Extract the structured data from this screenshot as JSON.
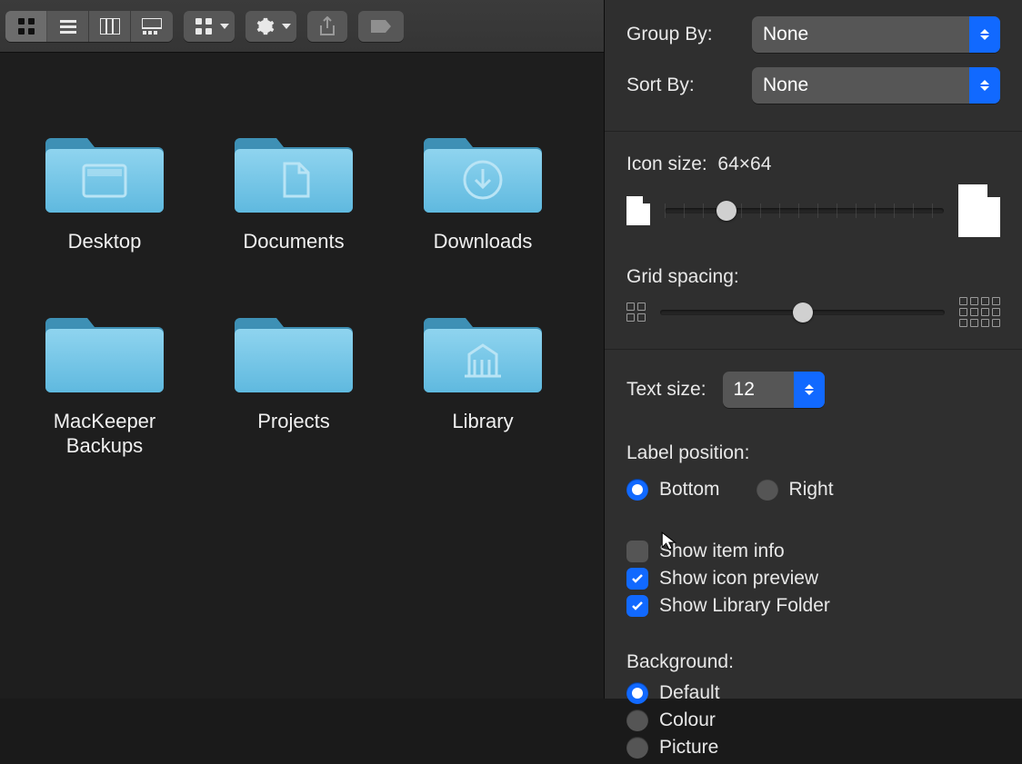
{
  "toolbar": {
    "view_modes": [
      "icon",
      "list",
      "column",
      "gallery"
    ],
    "active_view": "icon"
  },
  "folders": [
    {
      "name": "Desktop",
      "icon": "desktop"
    },
    {
      "name": "Documents",
      "icon": "document"
    },
    {
      "name": "Downloads",
      "icon": "download"
    },
    {
      "name": "MacKeeper Backups",
      "icon": "plain"
    },
    {
      "name": "Projects",
      "icon": "plain"
    },
    {
      "name": "Library",
      "icon": "library"
    }
  ],
  "options": {
    "group_by": {
      "label": "Group By:",
      "value": "None"
    },
    "sort_by": {
      "label": "Sort By:",
      "value": "None"
    },
    "icon_size": {
      "label": "Icon size:",
      "value": "64×64",
      "percent": 22
    },
    "grid_spacing": {
      "label": "Grid spacing:",
      "percent": 50
    },
    "text_size": {
      "label": "Text size:",
      "value": "12"
    },
    "label_position": {
      "label": "Label position:",
      "options": [
        "Bottom",
        "Right"
      ],
      "selected": "Bottom"
    },
    "checkboxes": [
      {
        "key": "show_item_info",
        "label": "Show item info",
        "checked": false
      },
      {
        "key": "show_icon_preview",
        "label": "Show icon preview",
        "checked": true
      },
      {
        "key": "show_library_folder",
        "label": "Show Library Folder",
        "checked": true
      }
    ],
    "background": {
      "label": "Background:",
      "options": [
        "Default",
        "Colour",
        "Picture"
      ],
      "selected": "Default"
    }
  }
}
